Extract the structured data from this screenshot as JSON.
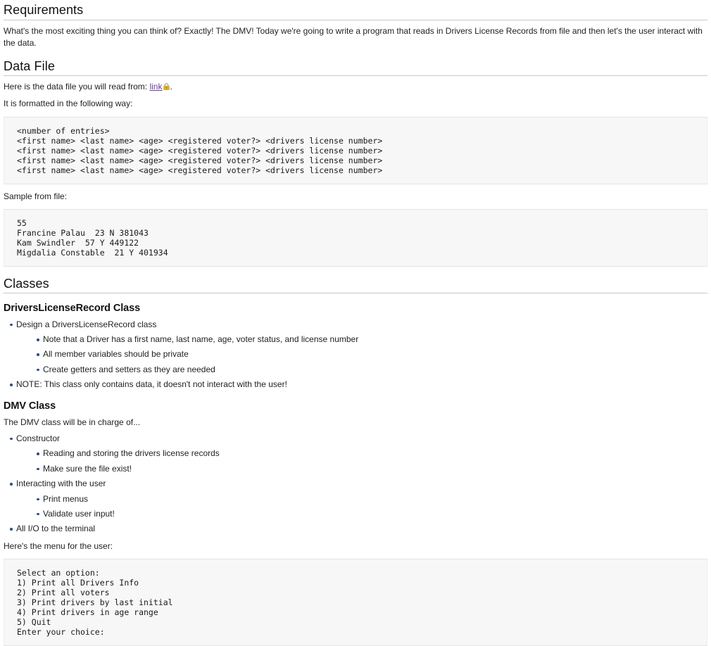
{
  "sections": {
    "requirements": {
      "heading": "Requirements",
      "intro": "What's the most exciting thing you can think of? Exactly! The DMV! Today we're going to write a program that reads in Drivers License Records from file and then let's the user interact with the data."
    },
    "data_file": {
      "heading": "Data File",
      "link_lead": "Here is the data file you will read from:",
      "link_label": "link",
      "link_trailing": ".",
      "lock_icon_name": "lock-icon",
      "format_lead": "It is formatted in the following way:",
      "format_code": "<number of entries>\n<first name> <last name> <age> <registered voter?> <drivers license number>\n<first name> <last name> <age> <registered voter?> <drivers license number>\n<first name> <last name> <age> <registered voter?> <drivers license number>\n<first name> <last name> <age> <registered voter?> <drivers license number>",
      "sample_lead": "Sample from file:",
      "sample_code": "55\nFrancine Palau  23 N 381043\nKam Swindler  57 Y 449122\nMigdalia Constable  21 Y 401934"
    },
    "classes": {
      "heading": "Classes",
      "record_class": {
        "heading": "DriversLicenseRecord Class",
        "bullets": [
          {
            "text": "Design a DriversLicenseRecord class",
            "children": [
              "Note that a Driver has a first name, last name, age, voter status, and license number",
              "All member variables should be private",
              "Create getters and setters as they are needed"
            ]
          },
          {
            "text": "NOTE: This class only contains data, it doesn't not interact with the user!",
            "children": []
          }
        ]
      },
      "dmv_class": {
        "heading": "DMV Class",
        "intro": "The DMV class will be in charge of...",
        "bullets": [
          {
            "text": "Constructor",
            "children": [
              "Reading and storing the drivers license records",
              "Make sure the file exist!"
            ]
          },
          {
            "text": "Interacting with the user",
            "children": [
              "Print menus",
              "Validate user input!"
            ]
          },
          {
            "text": "All I/O to the terminal",
            "children": []
          }
        ],
        "menu_lead": "Here's the menu for the user:",
        "menu_code": "Select an option:\n1) Print all Drivers Info\n2) Print all voters\n3) Print drivers by last initial\n4) Print drivers in age range\n5) Quit\nEnter your choice:"
      }
    }
  },
  "colors": {
    "bullet": "#2d4f8e",
    "link": "#6a3f9c",
    "code_background": "#f7f7f7",
    "heading_rule": "#c8c8c8",
    "text": "#222222",
    "lock_body": "#e8b923",
    "lock_shackle": "#9a9a9a"
  }
}
